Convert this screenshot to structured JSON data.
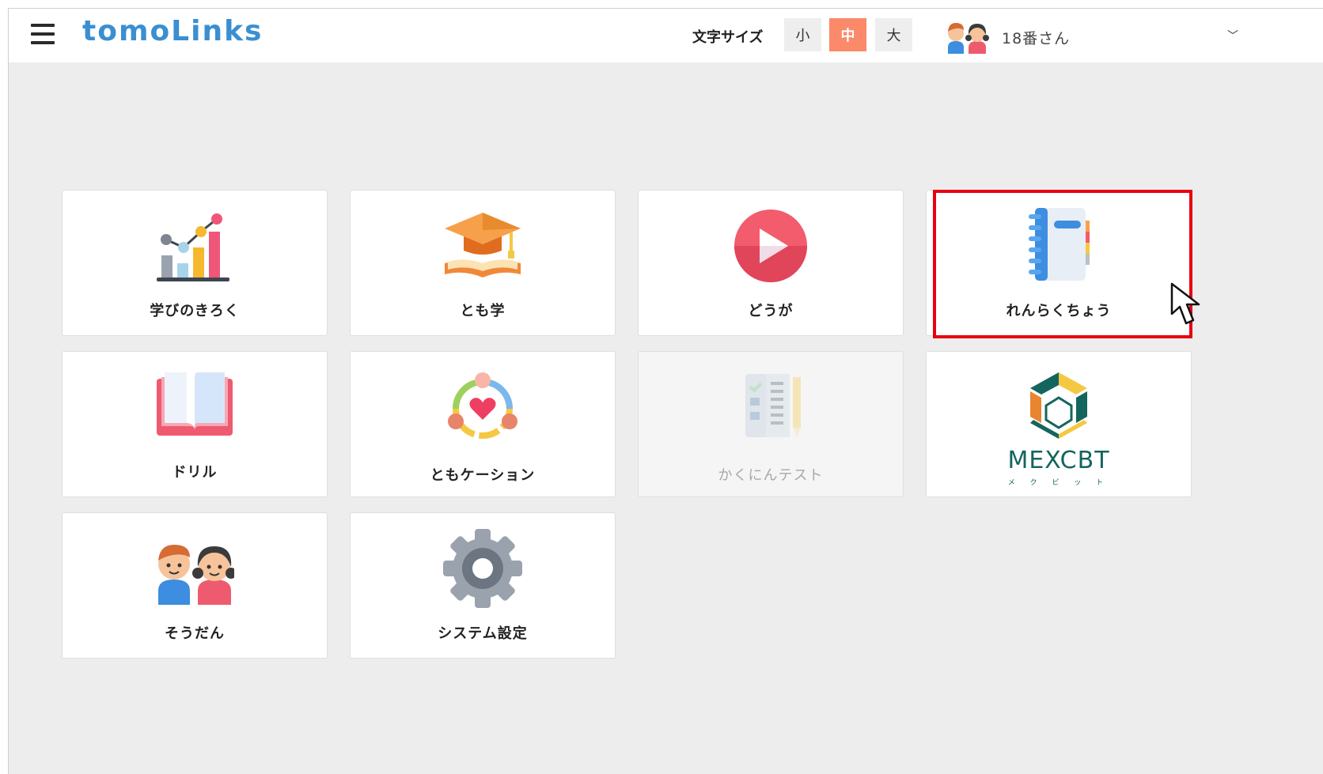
{
  "app": {
    "logo_text": "tomoLinks",
    "brand_color": "#3a8fd1"
  },
  "header": {
    "menu_icon": "hamburger-menu-icon",
    "font_size_label": "文字サイズ",
    "font_sizes": [
      "小",
      "中",
      "大"
    ],
    "font_size_selected": "中",
    "accent_color": "#fb8a6a",
    "user_name": "18番さん",
    "user_avatar_icon": "children-avatar-icon",
    "dropdown_icon": "chevron-down-icon",
    "dropdown_glyph": "﹀"
  },
  "tiles": [
    {
      "label": "学びのきろく",
      "icon": "learning-record-chart-icon",
      "enabled": true
    },
    {
      "label": "とも学",
      "icon": "graduation-cap-book-icon",
      "enabled": true
    },
    {
      "label": "どうが",
      "icon": "video-play-icon",
      "enabled": true
    },
    {
      "label": "れんらくちょう",
      "icon": "notebook-icon",
      "enabled": true,
      "highlighted": true
    },
    {
      "label": "ドリル",
      "icon": "open-book-icon",
      "enabled": true
    },
    {
      "label": "ともケーション",
      "icon": "heart-circle-icon",
      "enabled": true
    },
    {
      "label": "かくにんテスト",
      "icon": "checklist-pencil-icon",
      "enabled": false
    },
    {
      "label": "MEXCBT",
      "sublabel": "メ ク ビ ッ ト",
      "icon": "mexcbt-logo-icon",
      "enabled": true
    },
    {
      "label": "そうだん",
      "icon": "children-consult-icon",
      "enabled": true
    },
    {
      "label": "システム設定",
      "icon": "gear-icon",
      "enabled": true
    }
  ],
  "overlay": {
    "highlight_color": "#e60012",
    "pointer_icon": "mouse-pointer-icon"
  }
}
